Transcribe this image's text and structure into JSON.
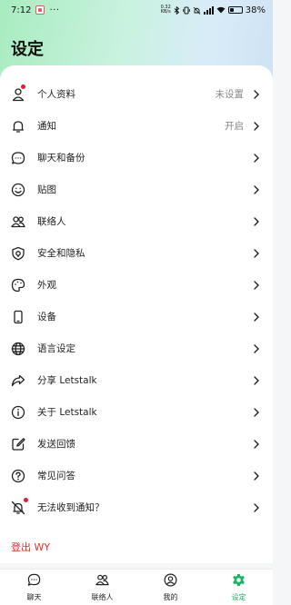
{
  "status_bar": {
    "time": "7:12",
    "more": "···",
    "net_speed": "0.32",
    "net_unit": "KB/s",
    "battery_pct": "38%",
    "battery_level": 0.38
  },
  "page": {
    "title": "设定"
  },
  "menu": [
    {
      "label": "个人资料",
      "value": "未设置",
      "icon": "person-icon",
      "badge": true
    },
    {
      "label": "通知",
      "value": "开启",
      "icon": "bell-icon",
      "badge": false
    },
    {
      "label": "聊天和备份",
      "value": "",
      "icon": "chat-bubble-icon",
      "badge": false
    },
    {
      "label": "贴图",
      "value": "",
      "icon": "smiley-icon",
      "badge": false
    },
    {
      "label": "联络人",
      "value": "",
      "icon": "contacts-icon",
      "badge": false
    },
    {
      "label": "安全和隐私",
      "value": "",
      "icon": "shield-icon",
      "badge": false
    },
    {
      "label": "外观",
      "value": "",
      "icon": "palette-icon",
      "badge": false
    },
    {
      "label": "设备",
      "value": "",
      "icon": "phone-icon",
      "badge": false
    },
    {
      "label": "语言设定",
      "value": "",
      "icon": "globe-icon",
      "badge": false
    },
    {
      "label": "分享 Letstalk",
      "value": "",
      "icon": "share-icon",
      "badge": false
    },
    {
      "label": "关于 Letstalk",
      "value": "",
      "icon": "info-icon",
      "badge": false
    },
    {
      "label": "发送回馈",
      "value": "",
      "icon": "feedback-icon",
      "badge": false
    },
    {
      "label": "常见问答",
      "value": "",
      "icon": "question-icon",
      "badge": false
    },
    {
      "label": "无法收到通知？",
      "value": "",
      "icon": "bell-off-icon",
      "badge": true
    }
  ],
  "logout": {
    "label": "登出 WY"
  },
  "tabbar": [
    {
      "label": "聊天",
      "icon": "chat-tab-icon",
      "active": false
    },
    {
      "label": "联络人",
      "icon": "contacts-tab-icon",
      "active": false
    },
    {
      "label": "我的",
      "icon": "profile-tab-icon",
      "active": false
    },
    {
      "label": "设定",
      "icon": "gear-tab-icon",
      "active": true
    }
  ],
  "colors": {
    "accent": "#21b26a",
    "danger": "#d9302c",
    "badge": "#e8192c"
  }
}
